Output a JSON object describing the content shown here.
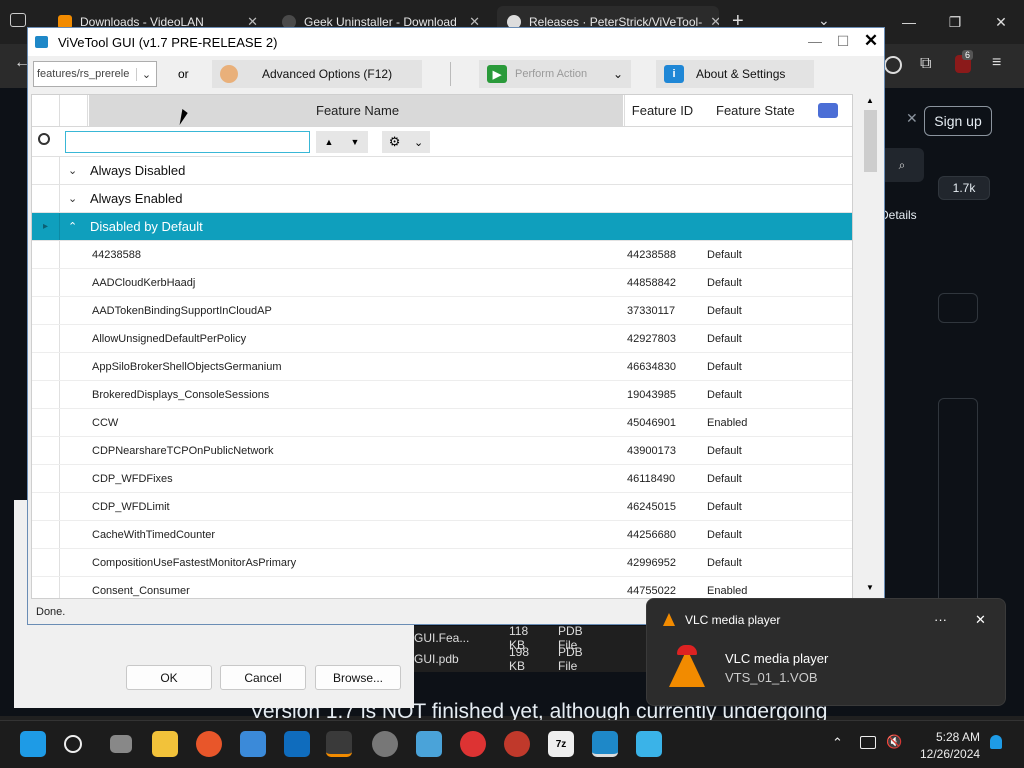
{
  "browser": {
    "tabs": [
      {
        "label": "Downloads - VideoLAN",
        "close": "✕"
      },
      {
        "label": "Geek Uninstaller - Download",
        "close": "✕"
      },
      {
        "label": "Releases · PeterStrick/ViVeTool-",
        "close": "✕"
      }
    ],
    "new_tab": "+",
    "gh": {
      "sign_up": "Sign up",
      "count": "1.7k",
      "details": "Details",
      "bg_text": "Version 1.7 is NOT finished yet, although currently undergoing",
      "extension_badge": "6"
    }
  },
  "file_dialog": {
    "ok": "OK",
    "cancel": "Cancel",
    "browse": "Browse...",
    "files": [
      {
        "name": "GUI.Fea...",
        "size": "118 KB",
        "type": "PDB File"
      },
      {
        "name": "GUI.pdb",
        "size": "198 KB",
        "type": "PDB File"
      }
    ]
  },
  "vive": {
    "title": "ViVeTool GUI (v1.7 PRE-RELEASE 2)",
    "branch_value": "features/rs_prerele",
    "or_label": "or",
    "advanced_options": "Advanced Options (F12)",
    "perform_action": "Perform Action",
    "about_settings": "About & Settings",
    "columns": {
      "name": "Feature Name",
      "id": "Feature ID",
      "state": "Feature State"
    },
    "search_value": "",
    "groups": [
      {
        "label": "Always Disabled",
        "chevron": "⌄"
      },
      {
        "label": "Always Enabled",
        "chevron": "⌄"
      },
      {
        "label": "Disabled by Default",
        "chevron": "⌃"
      }
    ],
    "rows": [
      {
        "name": "44238588",
        "id": "44238588",
        "state": "Default"
      },
      {
        "name": "AADCloudKerbHaadj",
        "id": "44858842",
        "state": "Default"
      },
      {
        "name": "AADTokenBindingSupportInCloudAP",
        "id": "37330117",
        "state": "Default"
      },
      {
        "name": "AllowUnsignedDefaultPerPolicy",
        "id": "42927803",
        "state": "Default"
      },
      {
        "name": "AppSiloBrokerShellObjectsGermanium",
        "id": "46634830",
        "state": "Default"
      },
      {
        "name": "BrokeredDisplays_ConsoleSessions",
        "id": "19043985",
        "state": "Default"
      },
      {
        "name": "CCW",
        "id": "45046901",
        "state": "Enabled"
      },
      {
        "name": "CDPNearshareTCPOnPublicNetwork",
        "id": "43900173",
        "state": "Default"
      },
      {
        "name": "CDP_WFDFixes",
        "id": "46118490",
        "state": "Default"
      },
      {
        "name": "CDP_WFDLimit",
        "id": "46245015",
        "state": "Default"
      },
      {
        "name": "CacheWithTimedCounter",
        "id": "44256680",
        "state": "Default"
      },
      {
        "name": "CompositionUseFastestMonitorAsPrimary",
        "id": "42996952",
        "state": "Default"
      },
      {
        "name": "Consent_Consumer",
        "id": "44755022",
        "state": "Enabled"
      }
    ],
    "status": "Done."
  },
  "toast": {
    "app": "VLC media player",
    "title": "VLC media player",
    "body": "VTS_01_1.VOB",
    "more": "···",
    "close": "✕"
  },
  "taskbar": {
    "time": "5:28 AM",
    "date": "12/26/2024"
  },
  "colors": {
    "accent": "#0f9fbd",
    "vlc": "#f28b00"
  }
}
